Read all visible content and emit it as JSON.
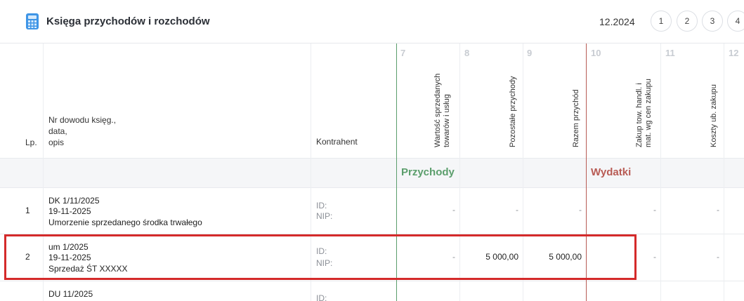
{
  "header": {
    "title": "Księga przychodów i rozchodów",
    "period": "12.2024",
    "pages": [
      "1",
      "2",
      "3",
      "4"
    ]
  },
  "columns": {
    "lp": "Lp.",
    "nr": "Nr dowodu księg.,\ndata,\nopis",
    "kontrahent": "Kontrahent",
    "numbers": [
      "7",
      "8",
      "9",
      "10",
      "11",
      "12"
    ],
    "c7": "Wartość sprzedanych\ntowarów i usług",
    "c8": "Pozostałe przychody",
    "c9": "Razem przychód",
    "c10": "Zakup tow. handl. i\nmat. wg cen zakupu",
    "c11": "Koszty ub. zakupu"
  },
  "sections": {
    "income": "Przychody",
    "expenses": "Wydatki"
  },
  "rows": [
    {
      "lp": "1",
      "doc": "DK 1/11/2025",
      "date": "19-11-2025",
      "desc": "Umorzenie sprzedanego środka trwałego",
      "id_label": "ID:",
      "nip_label": "NIP:",
      "c7": "-",
      "c8": "-",
      "c9": "-",
      "c10": "-",
      "c11": "-"
    },
    {
      "lp": "2",
      "doc": "um 1/2025",
      "date": "19-11-2025",
      "desc": "Sprzedaż ŚT XXXXX",
      "id_label": "ID:",
      "nip_label": "NIP:",
      "c7": "-",
      "c8": "5 000,00",
      "c9": "5 000,00",
      "c10": "-",
      "c11": "-"
    },
    {
      "lp": "",
      "doc": "DU 11/2025",
      "id_label": "ID:"
    }
  ],
  "colors": {
    "income": "#5b9e6c",
    "expenses": "#b85b54",
    "highlight": "#d42a2a"
  }
}
